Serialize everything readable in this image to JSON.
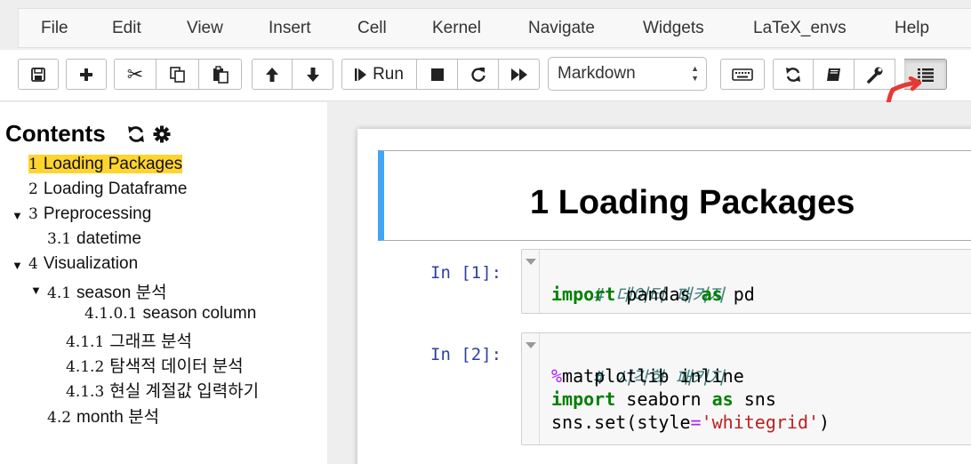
{
  "menubar": {
    "items": [
      "File",
      "Edit",
      "View",
      "Insert",
      "Cell",
      "Kernel",
      "Navigate",
      "Widgets",
      "LaTeX_envs",
      "Help"
    ]
  },
  "toolbar": {
    "run_label": "Run",
    "cell_type": "Markdown",
    "buttons": [
      "save-icon",
      "plus-icon",
      "cut-icon",
      "copy-icon",
      "paste-icon",
      "arrow-up-icon",
      "arrow-down-icon",
      "run-icon",
      "stop-icon",
      "restart-icon",
      "fast-forward-icon",
      "keyboard-icon",
      "refresh-icon",
      "book-icon",
      "wrench-icon",
      "list-icon"
    ],
    "active_button": "list-icon"
  },
  "toc": {
    "title": "Contents",
    "items": [
      {
        "num": "1",
        "label": "Loading Packages",
        "highlighted": true
      },
      {
        "num": "2",
        "label": "Loading Dataframe"
      },
      {
        "num": "3",
        "label": "Preprocessing",
        "expanded": true
      },
      {
        "num": "3.1",
        "label": "datetime"
      },
      {
        "num": "4",
        "label": "Visualization",
        "expanded": true
      },
      {
        "num": "4.1",
        "label": "season 분석",
        "expanded": true
      },
      {
        "num": "4.1.0.1",
        "label": "season column"
      },
      {
        "num": "4.1.1",
        "label": "그래프 분석"
      },
      {
        "num": "4.1.2",
        "label": "탐색적 데이터 분석"
      },
      {
        "num": "4.1.3",
        "label": "현실 계절값 입력하기"
      },
      {
        "num": "4.2",
        "label": "month 분석"
      }
    ]
  },
  "notebook": {
    "markdown_heading": "1  Loading Packages",
    "cells": [
      {
        "prompt": "In [1]:",
        "lines": [
          [
            {
              "t": "# 데이터 패키지",
              "c": "comment"
            }
          ],
          [
            {
              "t": "import",
              "c": "keyword"
            },
            {
              "t": " pandas ",
              "c": ""
            },
            {
              "t": "as",
              "c": "keyword"
            },
            {
              "t": " pd",
              "c": ""
            }
          ]
        ]
      },
      {
        "prompt": "In [2]:",
        "lines": [
          [
            {
              "t": "# 시각화 패키지",
              "c": "comment"
            }
          ],
          [
            {
              "t": "%",
              "c": "magic"
            },
            {
              "t": "matplotlib inline",
              "c": ""
            }
          ],
          [
            {
              "t": "import",
              "c": "keyword"
            },
            {
              "t": " seaborn ",
              "c": ""
            },
            {
              "t": "as",
              "c": "keyword"
            },
            {
              "t": " sns",
              "c": ""
            }
          ],
          [
            {
              "t": "sns.set(style",
              "c": ""
            },
            {
              "t": "=",
              "c": "op"
            },
            {
              "t": "'whitegrid'",
              "c": "string"
            },
            {
              "t": ")",
              "c": ""
            }
          ]
        ]
      }
    ]
  },
  "colors": {
    "toc_highlight": "#ffd42e",
    "markdown_border": "#42a5f5",
    "prompt": "#303f9f",
    "annotation_arrow": "#e53935"
  }
}
